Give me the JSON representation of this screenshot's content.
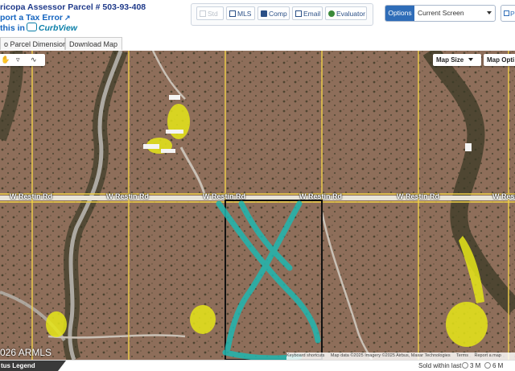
{
  "header": {
    "parcel_title": "ricopa Assessor Parcel # 503-93-408",
    "report_error": "port a Tax Error",
    "curbview_prefix": "this in",
    "curbview_logo": "CurbView"
  },
  "toolbar": {
    "std_label": "Std",
    "mls_label": "MLS",
    "comp_label": "Comp",
    "email_label": "Email",
    "evaluator_label": "Evaluator"
  },
  "options": {
    "button_label": "Options",
    "selected": "Current Screen",
    "print_label": "P"
  },
  "tabs": [
    {
      "label": "o Parcel Dimensions"
    },
    {
      "label": "Download Map"
    }
  ],
  "map": {
    "controls": {
      "map_size": "Map Size",
      "map_options": "Map Opti"
    },
    "road_labels": [
      "W Restin Rd",
      "W Restin Rd",
      "W Restin Rd",
      "W Restin Rd",
      "W Restin Rd",
      "W Restin Rd"
    ],
    "watermark": "026 ARMLS",
    "attribution": {
      "shortcuts": "Keyboard shortcuts",
      "data": "Map data ©2025 Imagery ©2025 Airbus, Maxar Technologies",
      "terms": "Terms",
      "report": "Report a map"
    },
    "colors": {
      "terrain": "#8a6a55",
      "parcel_line": "#f2d34a",
      "road": "#e8e4d8",
      "highlight": "#1fb7b0",
      "structure_highlight": "#e6e619"
    }
  },
  "footer": {
    "legend": "tus Legend",
    "sold_within": "Sold within last",
    "radio_3m": "3 M",
    "radio_6m": "6 M"
  }
}
